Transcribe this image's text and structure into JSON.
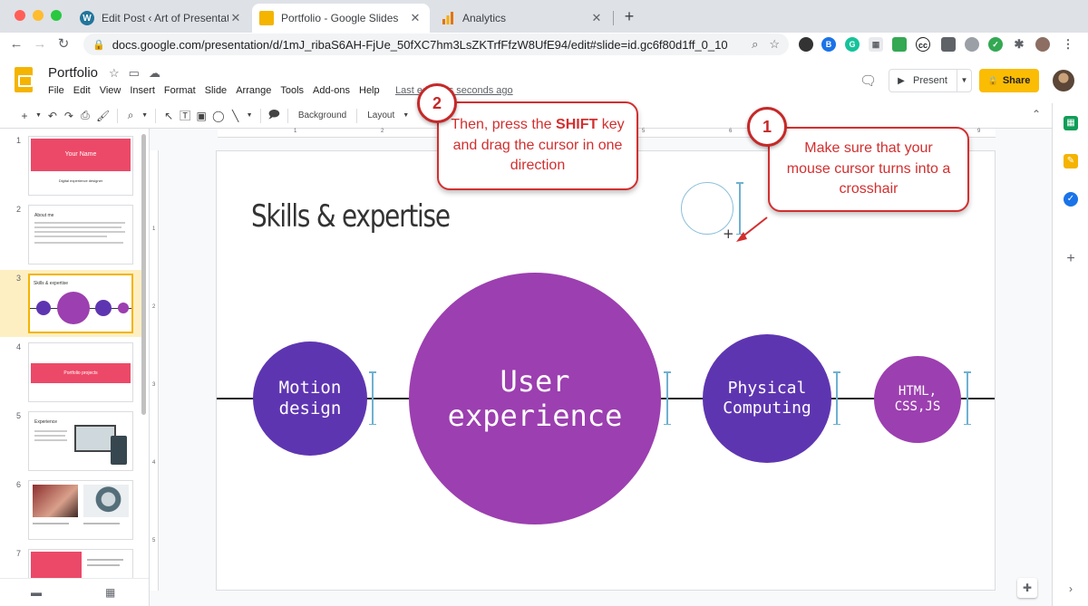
{
  "browser": {
    "tabs": [
      {
        "label": "Edit Post ‹ Art of Presentations"
      },
      {
        "label": "Portfolio - Google Slides"
      },
      {
        "label": "Analytics"
      }
    ],
    "close_glyph": "✕",
    "new_tab_glyph": "+",
    "url": "docs.google.com/presentation/d/1mJ_ribaS6AH-FjUe_50fXC7hm3LsZKTrfFfzW8UfE94/edit#slide=id.gc6f80d1ff_0_10"
  },
  "app": {
    "title": "Portfolio",
    "menu": [
      "File",
      "Edit",
      "View",
      "Insert",
      "Format",
      "Slide",
      "Arrange",
      "Tools",
      "Add-ons",
      "Help"
    ],
    "last_edit": "Last edit was seconds ago",
    "present_label": "Present",
    "share_label": "Share"
  },
  "toolbar": {
    "background_label": "Background",
    "layout_label": "Layout"
  },
  "filmstrip": {
    "slides": [
      {
        "num": "1",
        "name": "Your Name",
        "subtitle": "Digital experience designer"
      },
      {
        "num": "2",
        "heading": "About me"
      },
      {
        "num": "3",
        "heading": "Skills & expertise"
      },
      {
        "num": "4",
        "banner": "Portfolio projects"
      },
      {
        "num": "5",
        "heading": "Experience"
      },
      {
        "num": "6"
      },
      {
        "num": "7"
      }
    ]
  },
  "ruler": {
    "h_marks": [
      "1",
      "2",
      "3",
      "4",
      "5",
      "6",
      "7",
      "8",
      "9"
    ],
    "v_marks": [
      "1",
      "2",
      "3",
      "4",
      "5"
    ]
  },
  "slide": {
    "title": "Skills & expertise",
    "bubbles": [
      {
        "text": "Motion design",
        "color": "#5e35b1"
      },
      {
        "text": "User experience",
        "color": "#9c3fb0"
      },
      {
        "text": "Physical Computing",
        "color": "#5e35b1"
      },
      {
        "text": "HTML, CSS,JS",
        "color": "#9c3fb0"
      }
    ],
    "crosshair_glyph": "+"
  },
  "callouts": {
    "step1": {
      "badge": "1",
      "text": "Make sure that your mouse cursor turns into a crosshair"
    },
    "step2": {
      "badge": "2",
      "text_before": "Then, press the ",
      "text_bold": "SHIFT",
      "text_after": " key and drag the cursor in one direction"
    }
  },
  "colors": {
    "accent": "#f4b400",
    "callout_red": "#d32f2f",
    "slide_pink": "#ec4968"
  }
}
